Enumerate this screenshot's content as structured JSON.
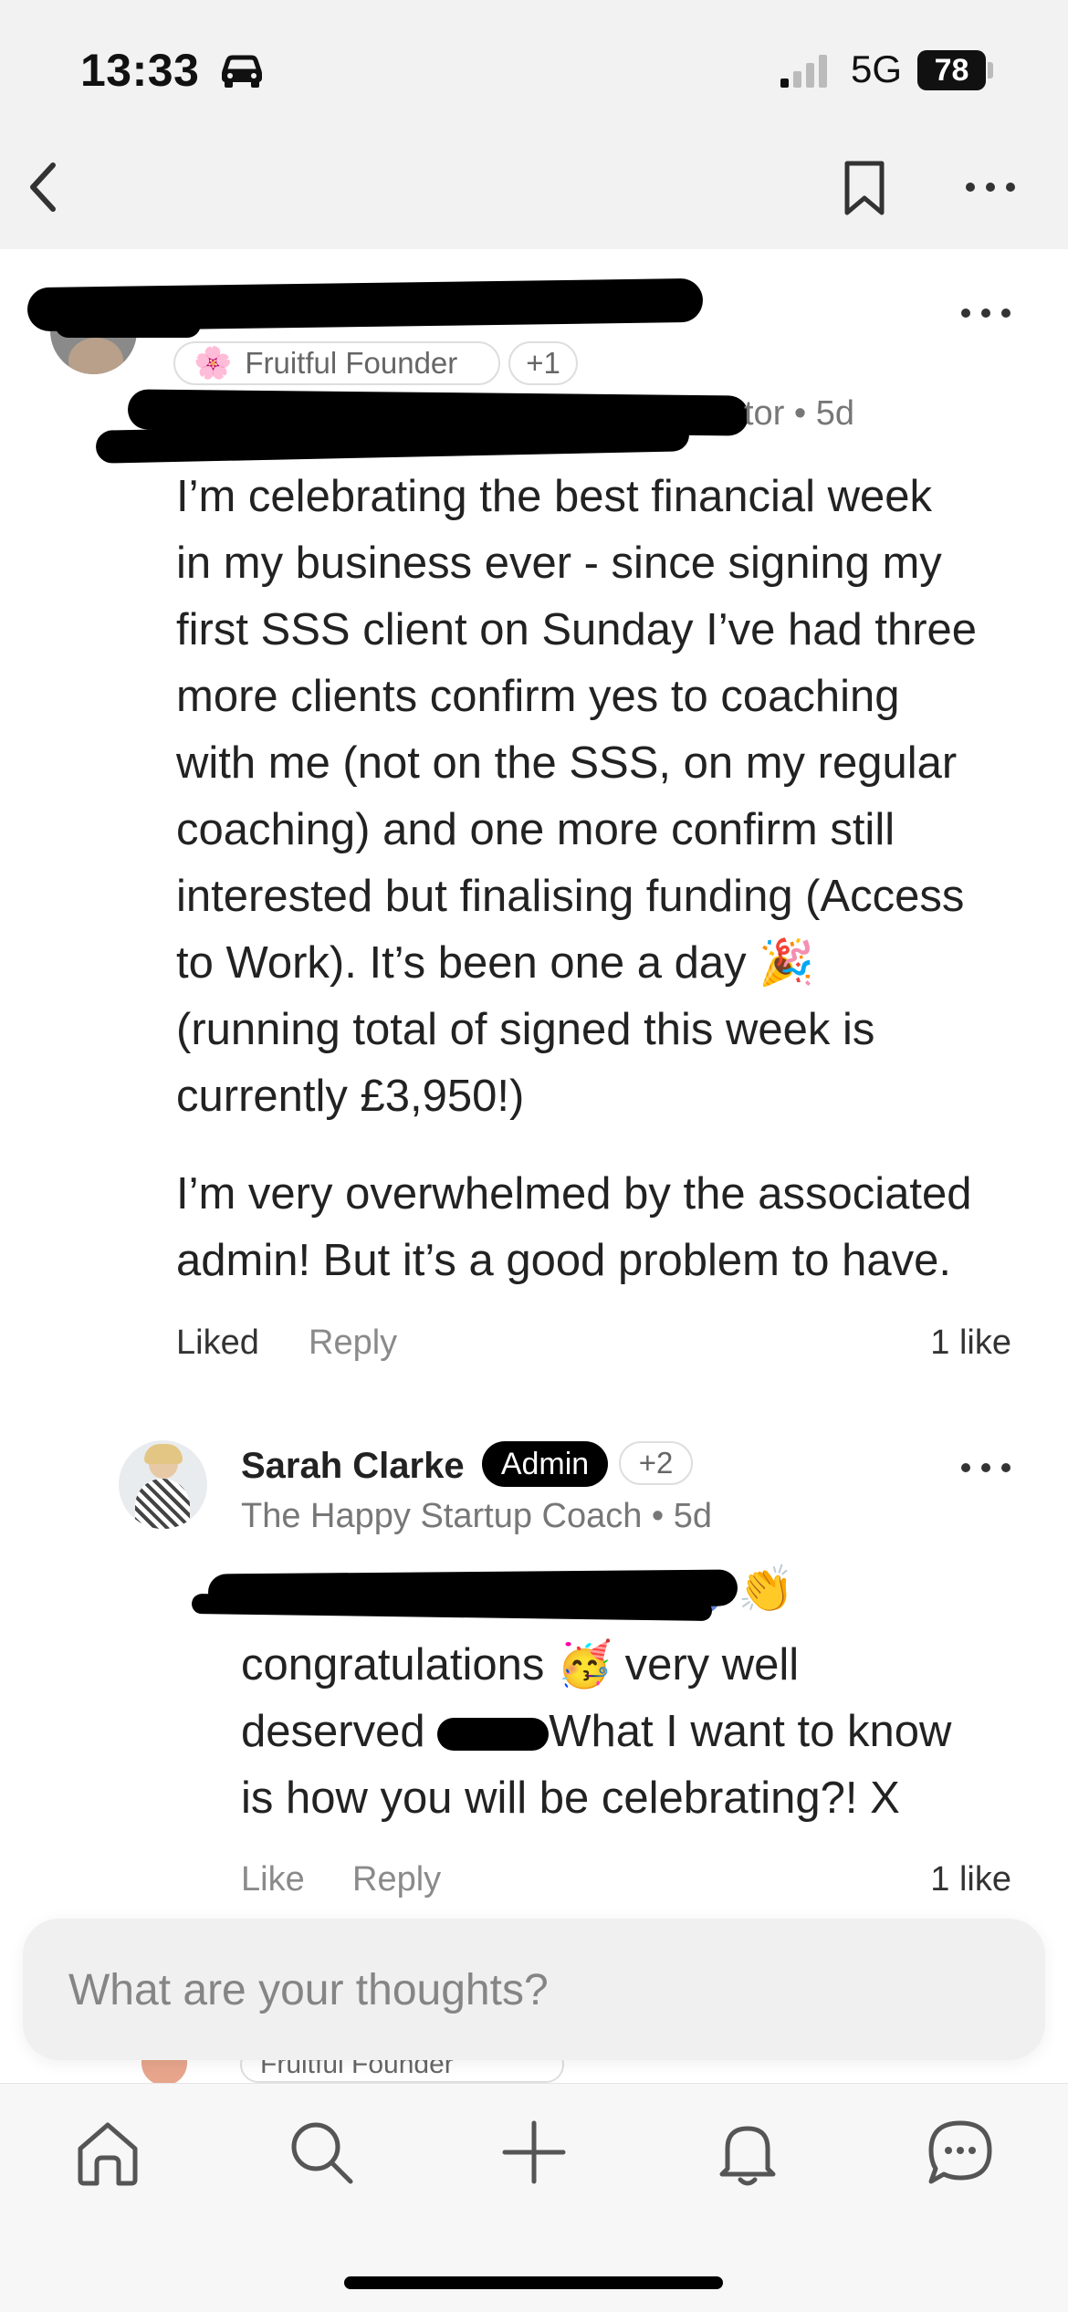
{
  "status_bar": {
    "time": "13:33",
    "network": "5G",
    "battery": "78"
  },
  "nav": {
    "back_icon": "chevron-left-icon",
    "bookmark_icon": "bookmark-icon",
    "more_icon": "more-horizontal-icon"
  },
  "post": {
    "badge_label": "Fruitful Founder",
    "badge_emoji": "🌸",
    "badge_extra": "+1",
    "meta_visible": "tor • 5d",
    "paragraph_1_lines": [
      "I’m celebrating the best financial week",
      "in my business ever - since signing my",
      "first SSS client on Sunday I’ve had three",
      "more clients confirm yes to coaching",
      "with me (not on the SSS, on my regular",
      "coaching) and one more confirm still",
      "interested but finalising funding (Access",
      "to Work). It’s been one a day 🎉",
      "(running total of signed this week is",
      "currently £3,950!)"
    ],
    "paragraph_2_lines": [
      "I’m very overwhelmed by the associated",
      "admin! But it’s a good problem to have."
    ],
    "liked_label": "Liked",
    "reply_label": "Reply",
    "likes": "1 like"
  },
  "comment": {
    "author": "Sarah Clarke",
    "admin_badge": "Admin",
    "badge_extra": "+2",
    "meta": "The Happy Startup Coach • 5d",
    "mention_emoji": "👏",
    "line_1": "congratulations 🥳 very well",
    "line_2_before": "deserved",
    "line_2_after": "What I want to know",
    "line_3": "is how you will be celebrating?! X",
    "like_label": "Like",
    "reply_label": "Reply",
    "likes": "1 like"
  },
  "next_comment_peek": {
    "badge_label": "Fruitful Founder"
  },
  "composer": {
    "placeholder": "What are your thoughts?"
  },
  "tabbar": {
    "items": [
      "home-icon",
      "search-icon",
      "plus-icon",
      "bell-icon",
      "chat-icon"
    ]
  }
}
